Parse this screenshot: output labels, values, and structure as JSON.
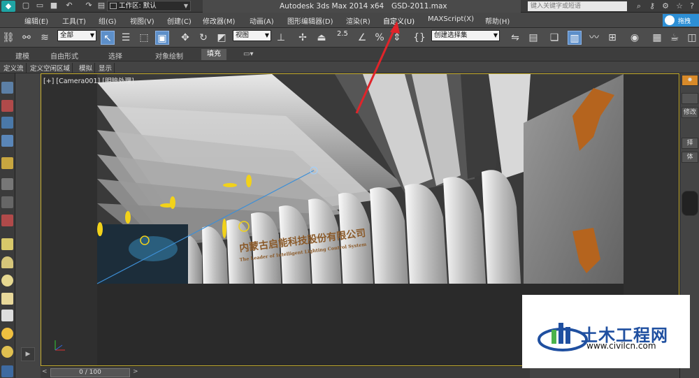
{
  "titlebar": {
    "workspace_label": "工作区: 默认",
    "app_name": "Autodesk 3ds Max  2014 x64",
    "file_name": "GSD-2011.max",
    "search_placeholder": "键入关键字或短语"
  },
  "menubar": {
    "items": [
      "编辑(E)",
      "工具(T)",
      "组(G)",
      "视图(V)",
      "创建(C)",
      "修改器(M)",
      "动画(A)",
      "图形编辑器(D)",
      "渲染(R)",
      "自定义(U)",
      "MAXScript(X)",
      "帮助(H)"
    ],
    "right_label": "拖拽"
  },
  "toolbar": {
    "selection_filter": "全部",
    "ref_coord": "视图",
    "snap_value": "2.5",
    "named_selection": "创建选择集"
  },
  "ribbon": {
    "tabs": [
      "建模",
      "自由形式",
      "选择",
      "对象绘制",
      "填充"
    ],
    "active_tab": "填充"
  },
  "subbar": {
    "tabs": [
      "定义流",
      "定义空闲区域",
      "模拟",
      "显示"
    ]
  },
  "viewport": {
    "label": "[+] [Camera001] [明暗处理]",
    "sign_cn": "内蒙古启能科技股份有限公司",
    "sign_en": "The Leader of Intelligent Lighting Control System"
  },
  "timeline": {
    "frame": "0 / 100"
  },
  "right_panel": {
    "modify_label": "修改",
    "sel_label": "择",
    "item2_label": "体"
  },
  "watermark": {
    "brand": "土木工程网",
    "url": "www.civilcn.com"
  },
  "colors": {
    "viewport_border": "#c8b030",
    "annotation_arrow": "#e0242a",
    "light_helper": "#f2d21a",
    "brand_blue": "#1f4fa0"
  }
}
